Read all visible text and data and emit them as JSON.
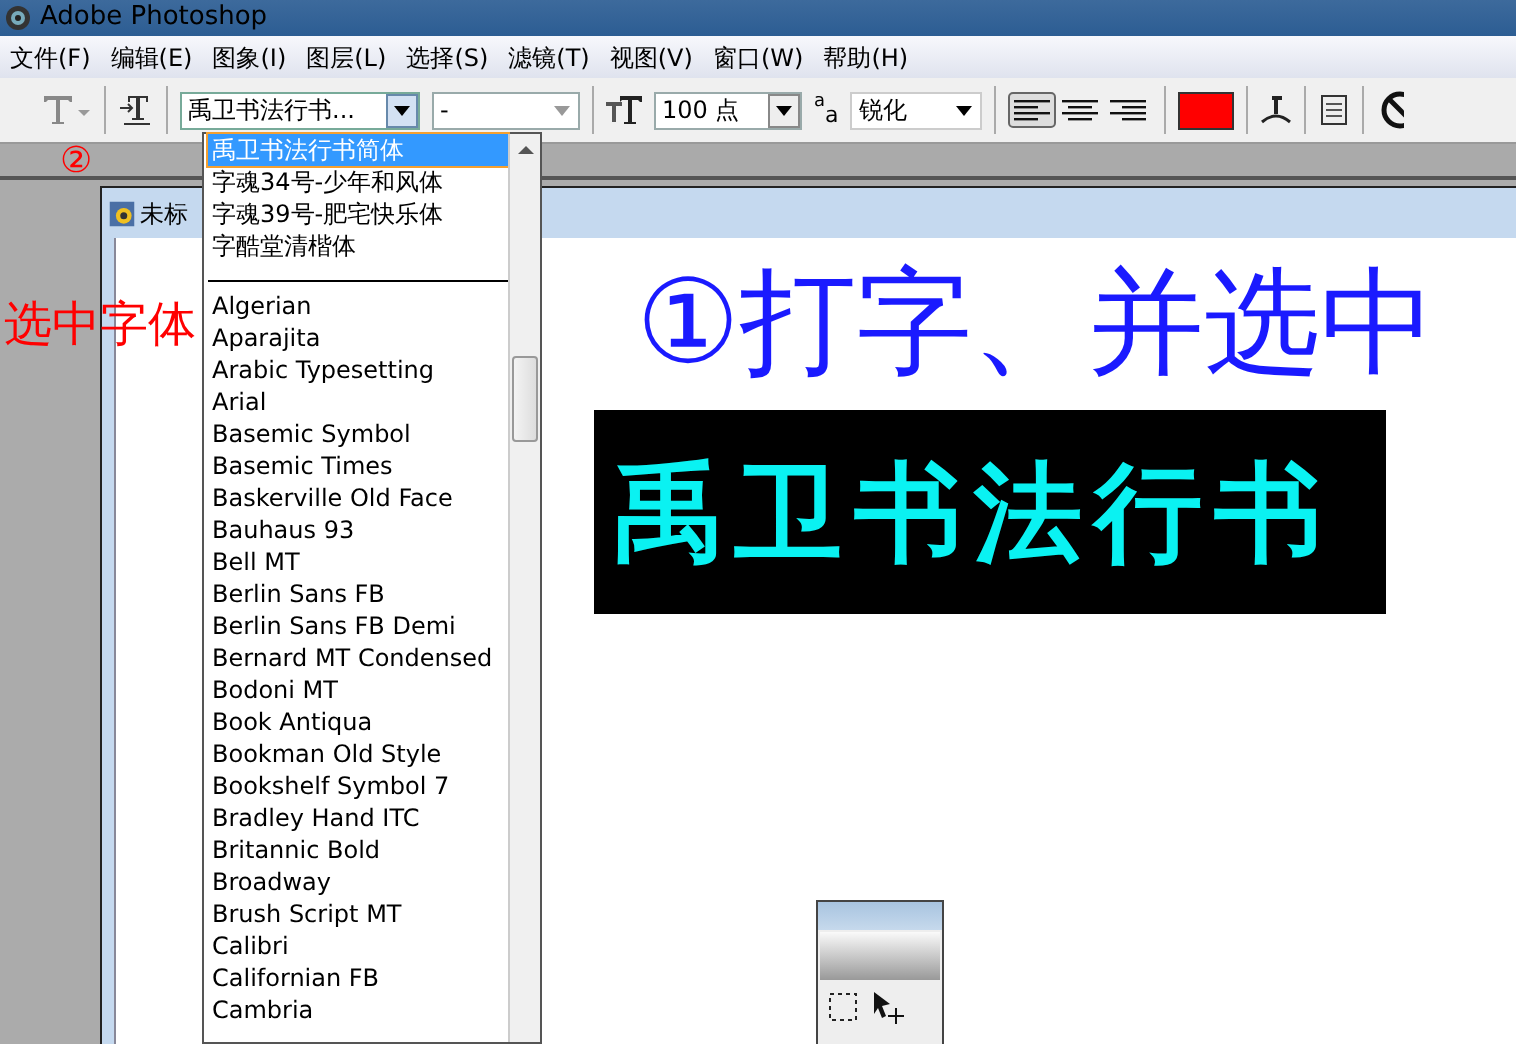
{
  "window": {
    "title": "Adobe Photoshop"
  },
  "menu": [
    "文件(F)",
    "编辑(E)",
    "图象(I)",
    "图层(L)",
    "选择(S)",
    "滤镜(T)",
    "视图(V)",
    "窗口(W)",
    "帮助(H)"
  ],
  "options_bar": {
    "font_family": "禹卫书法行书...",
    "font_style": "-",
    "font_size": "100 点",
    "antialias": "锐化",
    "antialias_glyphs": [
      "a",
      "a"
    ],
    "alignment": [
      {
        "selected": true
      },
      {
        "selected": false
      },
      {
        "selected": false
      }
    ]
  },
  "font_dropdown": {
    "recent": [
      {
        "label": "禹卫书法行书简体",
        "selected": true
      },
      {
        "label": "字魂34号-少年和风体",
        "selected": false
      },
      {
        "label": "字魂39号-肥宅快乐体",
        "selected": false
      },
      {
        "label": "字酷堂清楷体",
        "selected": false
      }
    ],
    "fonts": [
      "Algerian",
      "Aparajita",
      "Arabic Typesetting",
      "Arial",
      "Basemic Symbol",
      "Basemic Times",
      "Baskerville Old Face",
      "Bauhaus 93",
      "Bell MT",
      "Berlin Sans FB",
      "Berlin Sans FB Demi",
      "Bernard MT Condensed",
      "Bodoni MT",
      "Book Antiqua",
      "Bookman Old Style",
      "Bookshelf Symbol 7",
      "Bradley Hand ITC",
      "Britannic Bold",
      "Broadway",
      "Brush Script MT",
      "Calibri",
      "Californian FB",
      "Cambria"
    ]
  },
  "document": {
    "title": "未标",
    "text": "禹卫书法行书"
  },
  "annotations": [
    {
      "text": "②",
      "color": "#ff0000"
    },
    {
      "text": "选中字体",
      "color": "#ff0000"
    },
    {
      "text": "①打字、并选中",
      "color": "#1a1aff"
    }
  ]
}
